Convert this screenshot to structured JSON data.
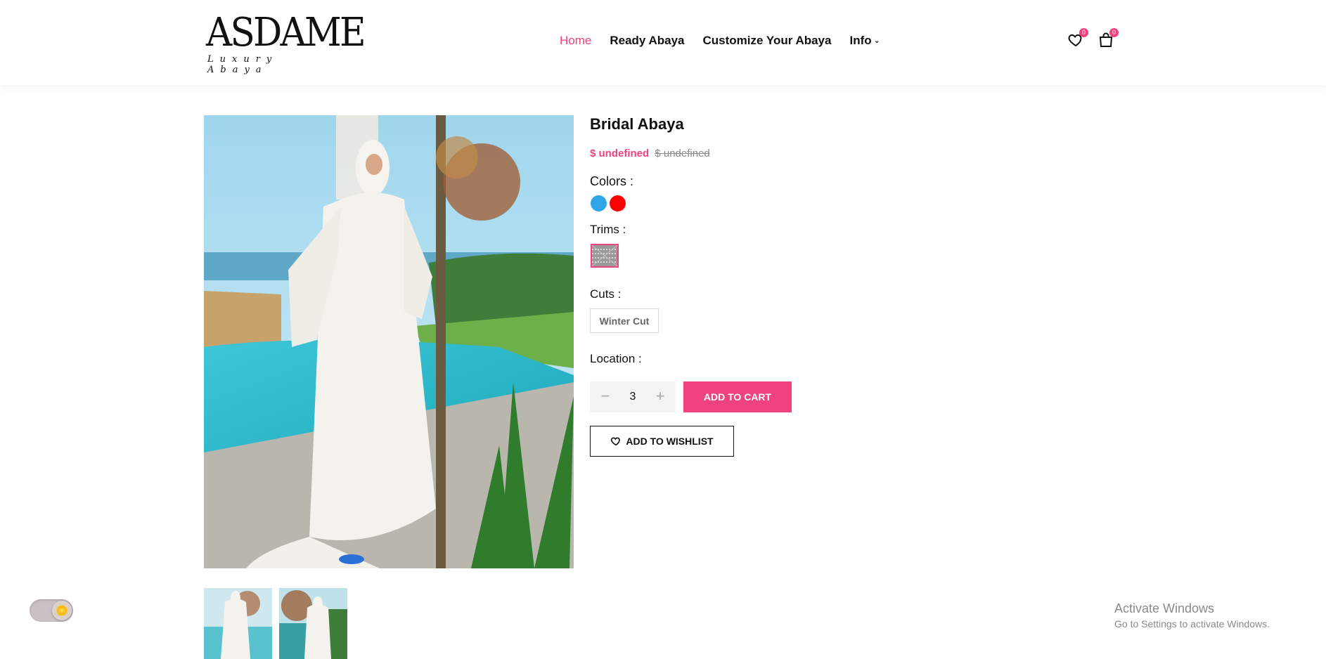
{
  "brand": {
    "logo_text": "ASDAME",
    "tagline": "Luxury Abaya"
  },
  "nav": {
    "items": [
      {
        "label": "Home",
        "active": true
      },
      {
        "label": "Ready Abaya",
        "active": false
      },
      {
        "label": "Customize Your Abaya",
        "active": false
      },
      {
        "label": "Info",
        "active": false,
        "has_dropdown": true
      }
    ]
  },
  "header_icons": {
    "wishlist": {
      "icon": "heart-icon",
      "count": "0"
    },
    "cart": {
      "icon": "shopping-bag-icon",
      "count": "0"
    }
  },
  "product": {
    "title": "Bridal Abaya",
    "price_sale": "$ undefined",
    "price_old": "$ undefined",
    "colors_label": "Colors :",
    "colors": [
      "#2fa4e7",
      "#ff0000"
    ],
    "trims_label": "Trims :",
    "cuts_label": "Cuts :",
    "cuts": [
      "Winter Cut"
    ],
    "location_label": "Location :",
    "quantity": "3",
    "add_to_cart": "ADD TO CART",
    "add_to_wishlist": "ADD TO WISHLIST"
  },
  "accent_color": "#f0427f",
  "windows_watermark": {
    "title": "Activate Windows",
    "subtitle": "Go to Settings to activate Windows."
  }
}
